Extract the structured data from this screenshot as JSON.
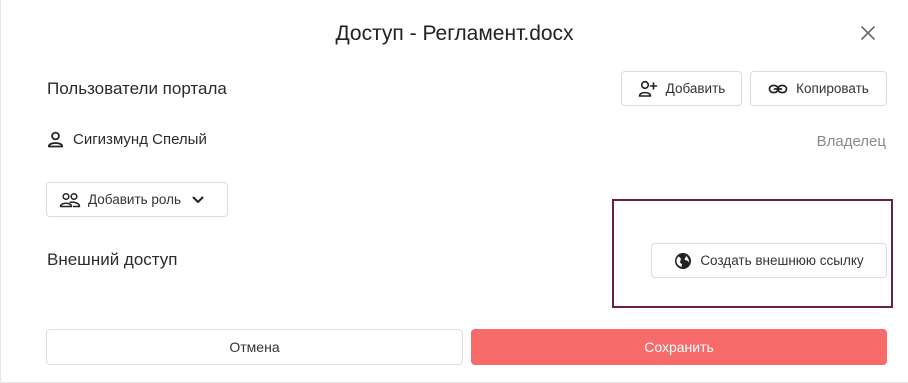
{
  "dialog": {
    "title": "Доступ - Регламент.docx"
  },
  "portal_users": {
    "label": "Пользователи портала",
    "add_label": "Добавить",
    "copy_label": "Копировать"
  },
  "user": {
    "name": "Сигизмунд Спелый",
    "role": "Владелец"
  },
  "add_role": {
    "label": "Добавить роль"
  },
  "external_access": {
    "label": "Внешний доступ",
    "create_link_label": "Создать внешнюю ссылку"
  },
  "footer": {
    "cancel_label": "Отмена",
    "save_label": "Сохранить"
  },
  "colors": {
    "save_button": "#f76b6b",
    "highlight_border": "#6e1e3e",
    "owner_text": "#8a8a8a"
  }
}
